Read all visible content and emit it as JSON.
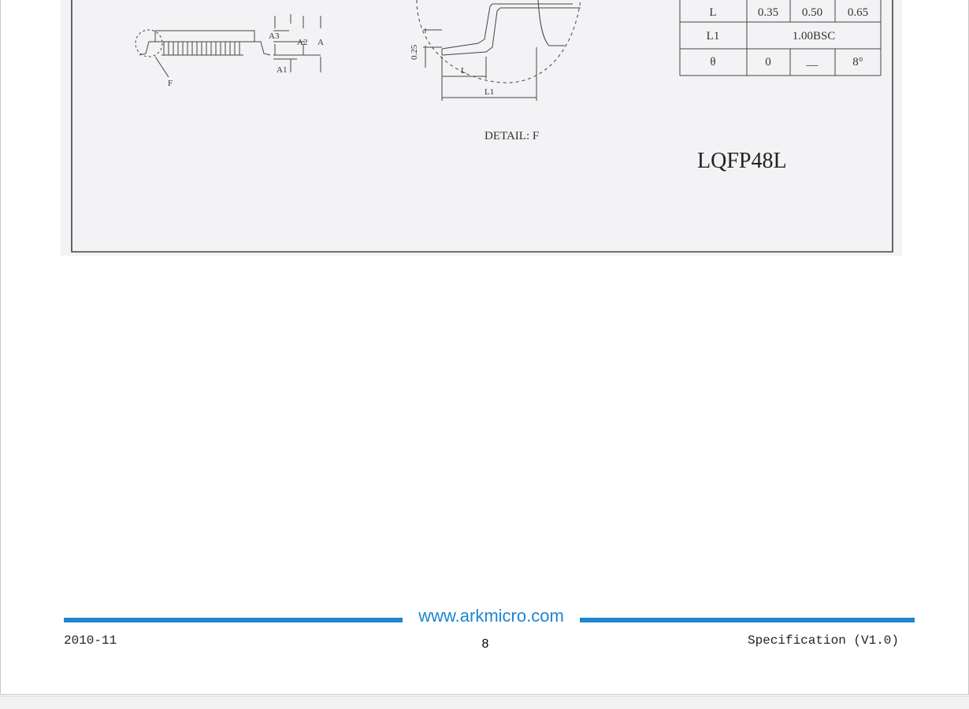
{
  "drawing": {
    "table": {
      "rows": [
        {
          "symbol": "L",
          "min": "0.35",
          "nom": "0.50",
          "max": "0.65"
        },
        {
          "symbol": "L1",
          "span": "1.00BSC"
        },
        {
          "symbol": "θ",
          "min": "0",
          "nom": "—",
          "max": "8°"
        }
      ]
    },
    "side_view_labels": {
      "a3": "A3",
      "a2": "A2",
      "a": "A",
      "a1": "A1",
      "f": "F"
    },
    "detail_labels": {
      "dim_025": "0.25",
      "l": "L",
      "l1": "L1"
    },
    "detail_caption": "DETAIL:  F",
    "package_name": "LQFP48L"
  },
  "footer": {
    "url": "www.arkmicro.com",
    "date": "2010-11",
    "page_number": "8",
    "spec": "Specification (V1.0)"
  },
  "colors": {
    "accent": "#1e86d0",
    "scan_background": "#f3f3f5",
    "line": "#333333"
  }
}
